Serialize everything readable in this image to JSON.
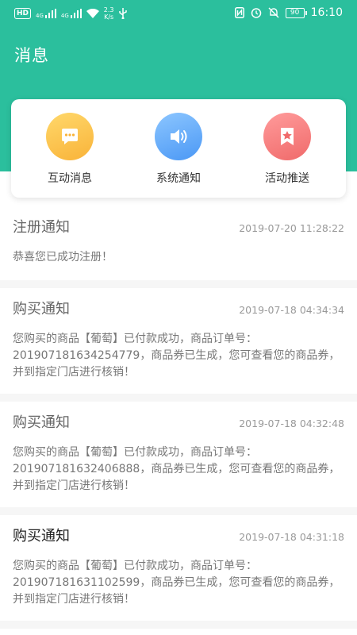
{
  "status_bar": {
    "hd": "HD",
    "net1": "4G",
    "net2": "4G",
    "speed_value": "2.3",
    "speed_unit": "K/s",
    "battery": "90",
    "time": "16:10"
  },
  "header": {
    "title": "消息"
  },
  "categories": [
    {
      "label": "互动消息",
      "icon": "chat-bubble-icon",
      "color": "#f9b339"
    },
    {
      "label": "系统通知",
      "icon": "speaker-icon",
      "color": "#4b98f5"
    },
    {
      "label": "活动推送",
      "icon": "star-bookmark-icon",
      "color": "#f06a6a"
    }
  ],
  "messages": [
    {
      "title": "注册通知",
      "time": "2019-07-20 11:28:22",
      "body": "恭喜您已成功注册！"
    },
    {
      "title": "购买通知",
      "time": "2019-07-18 04:34:34",
      "body": "您购买的商品【葡萄】已付款成功，商品订单号：201907181634254779，商品券已生成，您可查看您的商品券，并到指定门店进行核销！"
    },
    {
      "title": "购买通知",
      "time": "2019-07-18 04:32:48",
      "body": "您购买的商品【葡萄】已付款成功，商品订单号：201907181632406888，商品券已生成，您可查看您的商品券，并到指定门店进行核销！"
    },
    {
      "title": "购买通知",
      "time": "2019-07-18 04:31:18",
      "body": "您购买的商品【葡萄】已付款成功，商品订单号：201907181631102599，商品券已生成，您可查看您的商品券，并到指定门店进行核销！"
    }
  ],
  "colors": {
    "brand": "#2bbf9d",
    "background": "#ffffff",
    "divider": "#f6f6f6"
  }
}
